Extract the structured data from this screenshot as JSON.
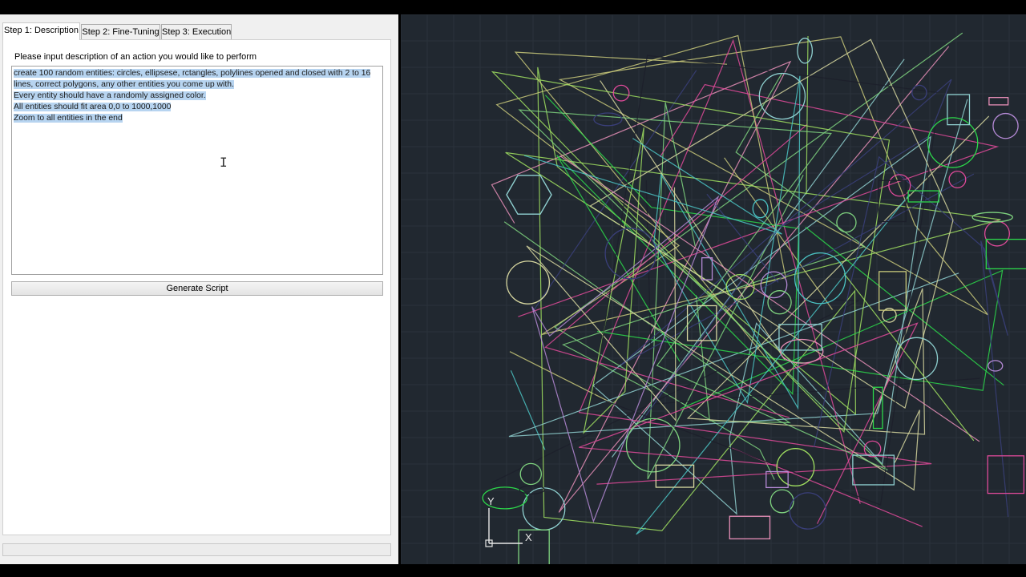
{
  "tabs": [
    {
      "label": "Step 1: Description",
      "active": true
    },
    {
      "label": "Step 2: Fine-Tuning",
      "active": false
    },
    {
      "label": "Step 3: Execution",
      "active": false
    }
  ],
  "description": {
    "prompt": "Please input description of an action you would like to perform",
    "lines": [
      "create 100 random entities: circles, ellipsese, rctangles, polylines opened and closed with 2 to 16",
      "lines, correct polygons, any other entities you come up with.",
      "Every entity should have a randomly assigned color.",
      "All entities should fit area 0,0 to 1000,1000",
      "Zoom to all entities in the end"
    ]
  },
  "generate_button": {
    "label": "Generate Script"
  },
  "cad": {
    "background": "#212830",
    "ucs_labels": {
      "y": "Y",
      "x": "X"
    },
    "entity_colors": [
      "#c9c97a",
      "#7fd37f",
      "#e04a9a",
      "#4bc4c4",
      "#b58ad6",
      "#d8d8a0",
      "#3a3f7a",
      "#2cd84a",
      "#e88fb8",
      "#8fd0d0",
      "#1c1f2a",
      "#a0e060"
    ]
  }
}
